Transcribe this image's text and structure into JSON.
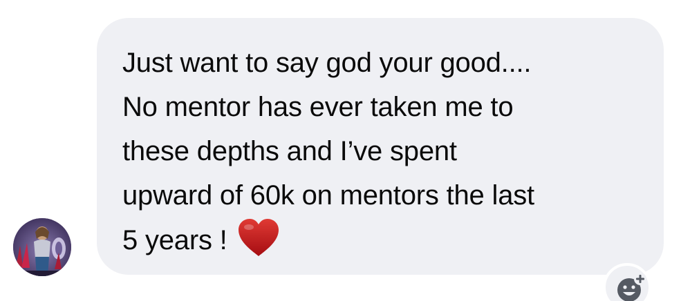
{
  "message": {
    "lines": [
      "Just want to say god your good....",
      "No mentor has ever taken me to",
      "these depths and I’ve spent",
      "upward of 60k on mentors the last",
      "5 years !"
    ],
    "trailing_icon": "red-heart-icon"
  },
  "sender": {
    "avatar_icon": "profile-photo"
  },
  "actions": {
    "react_icon": "add-reaction-icon"
  },
  "colors": {
    "bubble_background": "#eff0f4",
    "text": "#0a0a0a",
    "heart": "#c8141a",
    "icon": "#555a63"
  }
}
